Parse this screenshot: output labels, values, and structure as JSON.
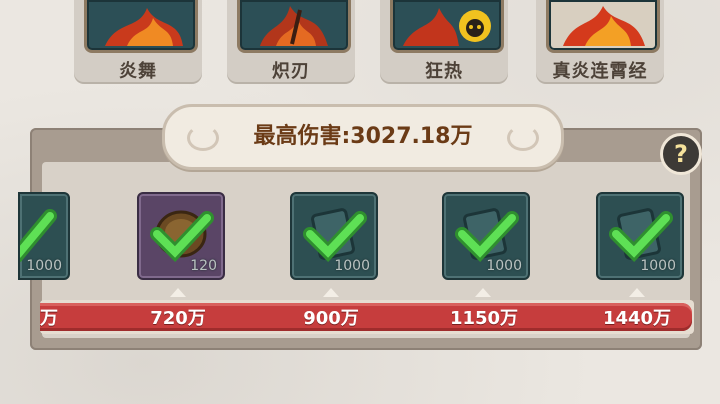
{
  "skills": [
    {
      "label": "炎舞"
    },
    {
      "label": "炽刃"
    },
    {
      "label": "狂热"
    },
    {
      "label": "真炎连霄经"
    }
  ],
  "panel": {
    "max_damage_label": "最高伤害:3027.18万",
    "help_symbol": "?"
  },
  "rewards": [
    {
      "qty": "1000",
      "icon": "token-icon",
      "claimed": true,
      "partial": true
    },
    {
      "qty": "120",
      "icon": "coin-icon",
      "claimed": true
    },
    {
      "qty": "1000",
      "icon": "token-icon",
      "claimed": true
    },
    {
      "qty": "1000",
      "icon": "token-icon",
      "claimed": true
    },
    {
      "qty": "1000",
      "icon": "token-icon",
      "claimed": true
    }
  ],
  "thresholds": [
    {
      "label": "万",
      "partial": true
    },
    {
      "label": "720万"
    },
    {
      "label": "900万"
    },
    {
      "label": "1150万"
    },
    {
      "label": "1440万"
    }
  ],
  "colors": {
    "bar": "#c63d3d",
    "check": "#4fcf48",
    "title": "#6b3b16"
  }
}
